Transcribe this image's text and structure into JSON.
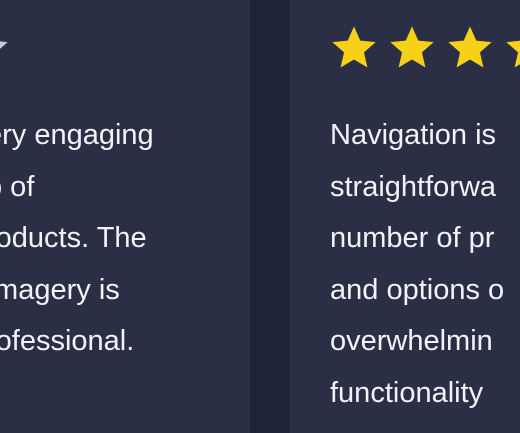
{
  "colors": {
    "page_background": "#1f2337",
    "card_background": "#2a2f45",
    "star_filled": "#f7d117",
    "star_empty": "#c9cbd3",
    "text": "#f2f3f7"
  },
  "reviews": [
    {
      "rating_icons": [
        "star-empty-icon"
      ],
      "text": "ery engaging\nb of\nroducts. The\nImagery is\nrofessional."
    },
    {
      "rating_icons": [
        "star-filled-icon",
        "star-filled-icon",
        "star-filled-icon",
        "star-partial-icon"
      ],
      "text": "Navigation is\nstraightforwa\nnumber of pr\nand options o\noverwhelmin\nfunctionality\n"
    }
  ]
}
